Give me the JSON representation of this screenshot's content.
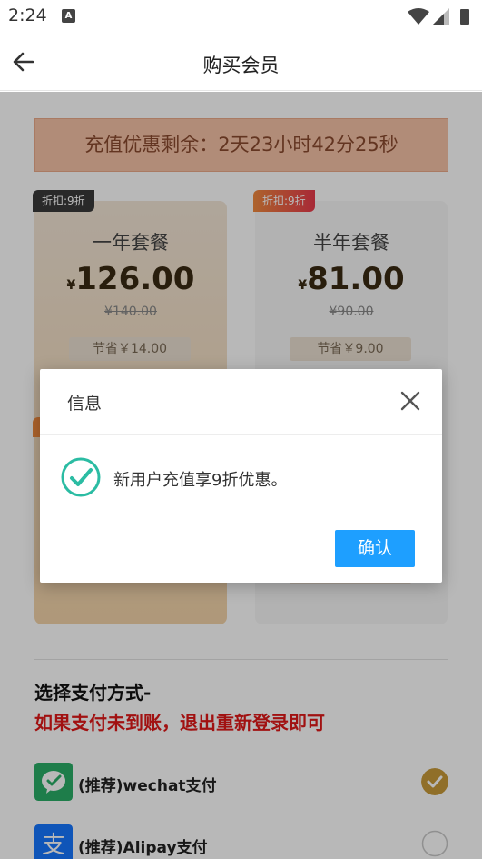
{
  "status_bar": {
    "time": "2:24",
    "notification_icon": "A"
  },
  "header": {
    "title": "购买会员"
  },
  "countdown": {
    "text": "充值优惠剩余：2天23小时42分25秒"
  },
  "plans": [
    {
      "tag": "折扣:9折",
      "name": "一年套餐",
      "currency": "¥",
      "price": "126.00",
      "original": "¥140.00",
      "save": "节省￥14.00",
      "selected": true
    },
    {
      "tag": "折扣:9折",
      "name": "半年套餐",
      "currency": "¥",
      "price": "81.00",
      "original": "¥90.00",
      "save": "节省￥9.00",
      "selected": false
    }
  ],
  "payment": {
    "title": "选择支付方式-",
    "warning": "如果支付未到账，退出重新登录即可",
    "options": [
      {
        "label": "(推荐)wechat支付",
        "selected": true
      },
      {
        "label": "(推荐)Alipay支付",
        "selected": false
      }
    ]
  },
  "dialog": {
    "title": "信息",
    "message": "新用户充值享9折优惠。",
    "ok_label": "确认"
  },
  "colors": {
    "accent_blue": "#1e9fff",
    "warning_red": "#e01818",
    "countdown_bg": "#f5c2a7",
    "wechat_green": "#2aae67",
    "alipay_blue": "#1677ff",
    "check_teal": "#2bbca3"
  }
}
